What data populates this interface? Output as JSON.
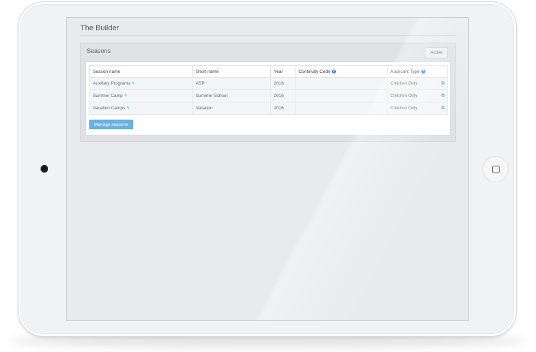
{
  "page": {
    "title": "The Builder"
  },
  "panel": {
    "title": "Seasons",
    "status": "Active",
    "columns": [
      "Season name",
      "Short name",
      "Year",
      "Continuity Code",
      "Applicant Type"
    ],
    "rows": [
      {
        "name": "Auxiliary Programs",
        "short": "ASP",
        "year": "2016",
        "code": "",
        "applicant": "Children Only"
      },
      {
        "name": "Summer Camp",
        "short": "Summer School",
        "year": "2016",
        "code": "",
        "applicant": "Children Only"
      },
      {
        "name": "Vacation Camps",
        "short": "Vacation",
        "year": "2016",
        "code": "",
        "applicant": "Children Only"
      }
    ],
    "manage_label": "Manage seasons"
  },
  "icons": {
    "help": "question-circle-icon",
    "edit": "pencil-icon",
    "copy": "copy-icon"
  },
  "colors": {
    "accent": "#6eb0e3",
    "icon": "#3f8fd0"
  }
}
